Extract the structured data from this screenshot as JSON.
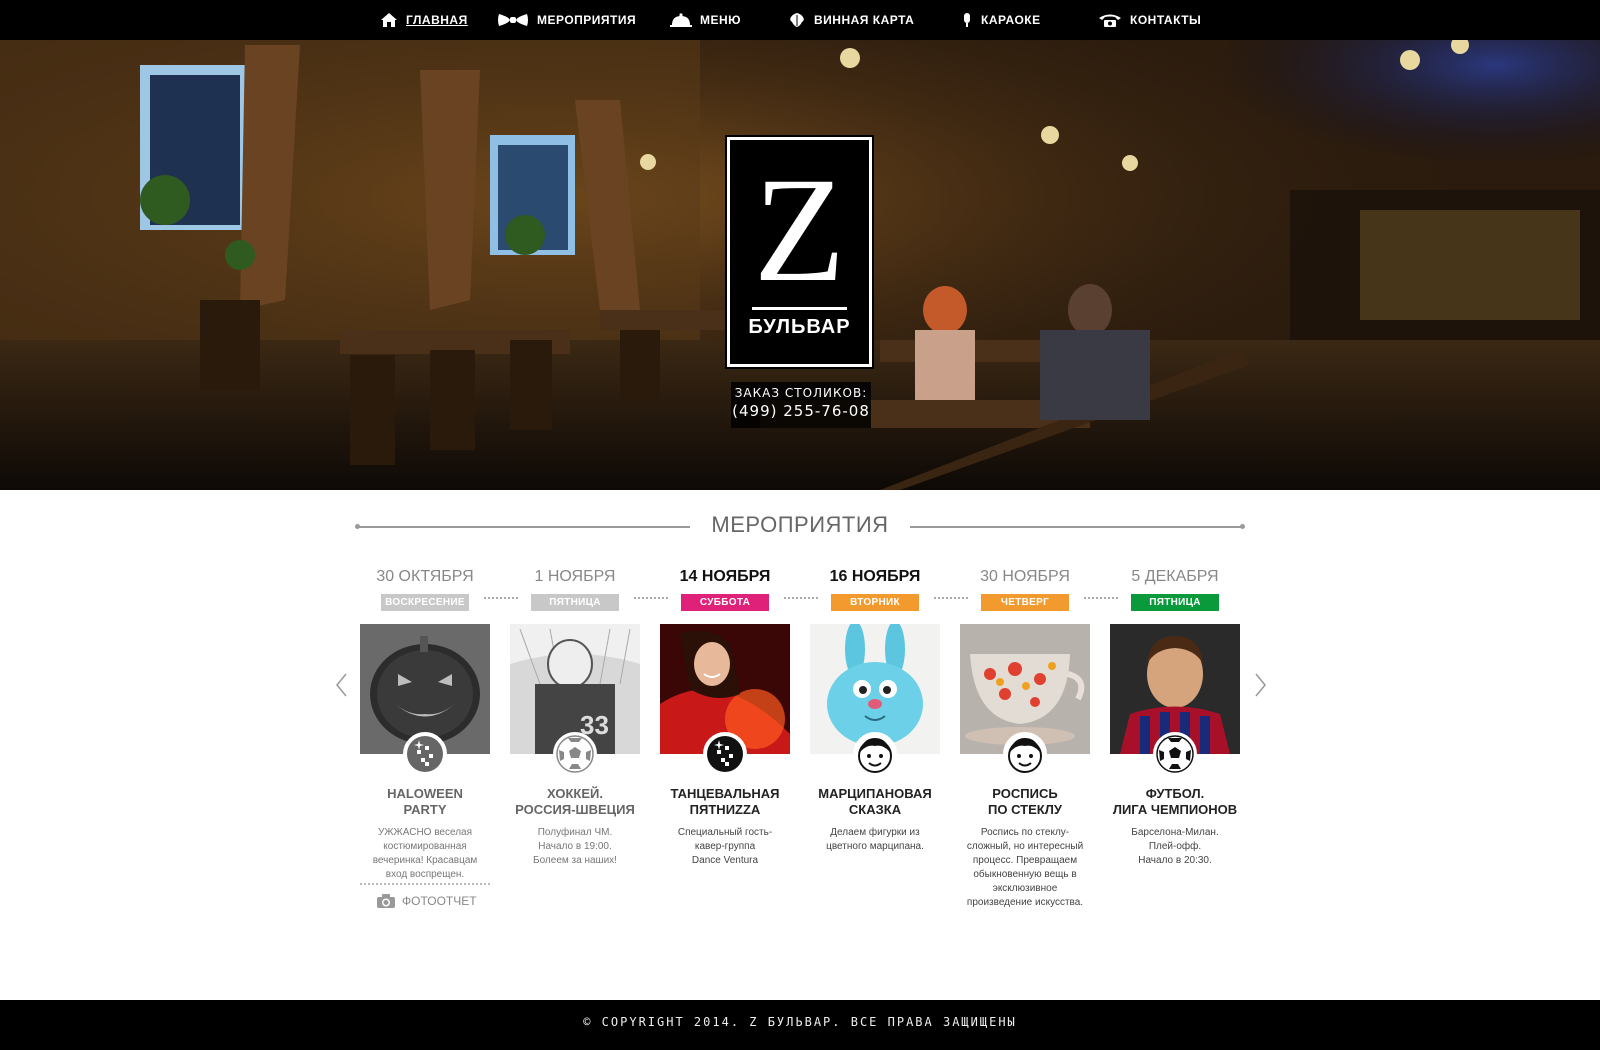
{
  "nav": {
    "items": [
      {
        "label": "ГЛАВНАЯ",
        "icon": "home-icon"
      },
      {
        "label": "МЕРОПРИЯТИЯ",
        "icon": "bowtie-icon"
      },
      {
        "label": "МЕНЮ",
        "icon": "cloche-icon"
      },
      {
        "label": "ВИННАЯ КАРТА",
        "icon": "grape-leaf-icon"
      },
      {
        "label": "КАРАОКЕ",
        "icon": "microphone-icon"
      },
      {
        "label": "КОНТАКТЫ",
        "icon": "phone-icon"
      }
    ]
  },
  "hero": {
    "logo_letter": "Z",
    "logo_name": "БУЛЬВАР",
    "booking_label": "ЗАКАЗ СТОЛИКОВ:",
    "booking_phone": "(499) 255-76-08"
  },
  "events_section": {
    "title": "МЕРОПРИЯТИЯ",
    "events": [
      {
        "date": "30 ОКТЯБРЯ",
        "day": "ВОСКРЕСЕНИЕ",
        "day_color": "#c8c8c8",
        "title": "HALOWEEN\nPARTY",
        "desc": "УЖЖАСНО веселая\nкостюмированная\nвечеринка! Красавцам\nвход воспрещен.",
        "badge_icon": "disco-ball-icon",
        "past": true
      },
      {
        "date": "1 НОЯБРЯ",
        "day": "ПЯТНИЦА",
        "day_color": "#c8c8c8",
        "title": "ХОККЕЙ.\nРОССИЯ-ШВЕЦИЯ",
        "desc": "Полуфинал ЧМ.\nНачало в 19:00.\nБолеем за наших!",
        "badge_icon": "soccer-ball-icon",
        "past": true
      },
      {
        "date": "14 НОЯБРЯ",
        "day": "СУББОТА",
        "day_color": "#e0217a",
        "title": "ТАНЦЕВАЛЬНАЯ\nПЯТНИZZA",
        "desc": "Специальный гость-\nкавер-группа\nDance Ventura",
        "badge_icon": "disco-ball-icon",
        "past": false
      },
      {
        "date": "16 НОЯБРЯ",
        "day": "ВТОРНИК",
        "day_color": "#f29a2e",
        "title": "МАРЦИПАНОВАЯ\nСКАЗКА",
        "desc": "Делаем фигурки из\nцветного марципана.",
        "badge_icon": "kid-face-icon",
        "past": false
      },
      {
        "date": "30 НОЯБРЯ",
        "day": "ЧЕТВЕРГ",
        "day_color": "#f29a2e",
        "title": "РОСПИСЬ\nПО СТЕКЛУ",
        "desc": "Роспись по стеклу-\nсложный, но интересный\nпроцесс. Превращаем\nобыкновенную вещь в\nэксклюзивное\nпроизведение искусства.",
        "badge_icon": "kid-face-icon",
        "past": false
      },
      {
        "date": "5 ДЕКАБРЯ",
        "day": "ПЯТНИЦА",
        "day_color": "#0a9a3c",
        "title": "ФУТБОЛ.\nЛИГА ЧЕМПИОНОВ",
        "desc": "Барселона-Милан.\nПлей-офф.\nНачало в 20:30.",
        "badge_icon": "soccer-ball-icon",
        "past": false
      }
    ],
    "photo_report_label": "ФОТООТЧЕТ"
  },
  "footer": {
    "copyright": "© COPYRIGHT 2014. Z БУЛЬВАР. ВСЕ ПРАВА ЗАЩИЩЕНЫ"
  }
}
